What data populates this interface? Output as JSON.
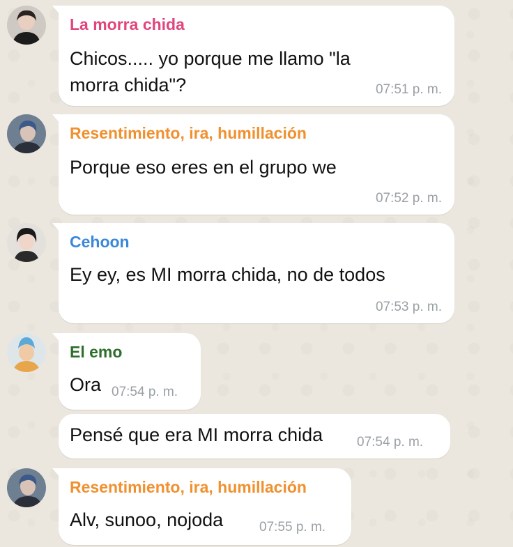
{
  "colors": {
    "background": "#ece7de",
    "bubble": "#ffffff",
    "sender_pink": "#e0457b",
    "sender_orange": "#f0902e",
    "sender_blue": "#3a88d8",
    "sender_green": "#2e6e2b",
    "time": "#9aa0a4"
  },
  "messages": [
    {
      "sender": "La morra chida",
      "text_line1": "Chicos..... yo porque me llamo \"la",
      "text_line2": "morra chida\"?",
      "time": "07:51 p. m.",
      "avatar": "avatar-la-morra-chida"
    },
    {
      "sender": "Resentimiento, ira, humillación",
      "text": "Porque eso eres en el grupo we",
      "time": "07:52 p. m.",
      "avatar": "avatar-resentimiento"
    },
    {
      "sender": "Cehoon",
      "text": "Ey ey, es MI morra chida, no de todos",
      "time": "07:53 p. m.",
      "avatar": "avatar-cehoon"
    },
    {
      "sender": "El emo",
      "text": "Ora",
      "time": "07:54 p. m.",
      "avatar": "avatar-el-emo"
    },
    {
      "text": "Pensé que era MI morra chida",
      "time": "07:54 p. m."
    },
    {
      "sender": "Resentimiento, ira, humillación",
      "text": "Alv, sunoo, nojoda",
      "time": "07:55 p. m.",
      "avatar": "avatar-resentimiento"
    }
  ]
}
